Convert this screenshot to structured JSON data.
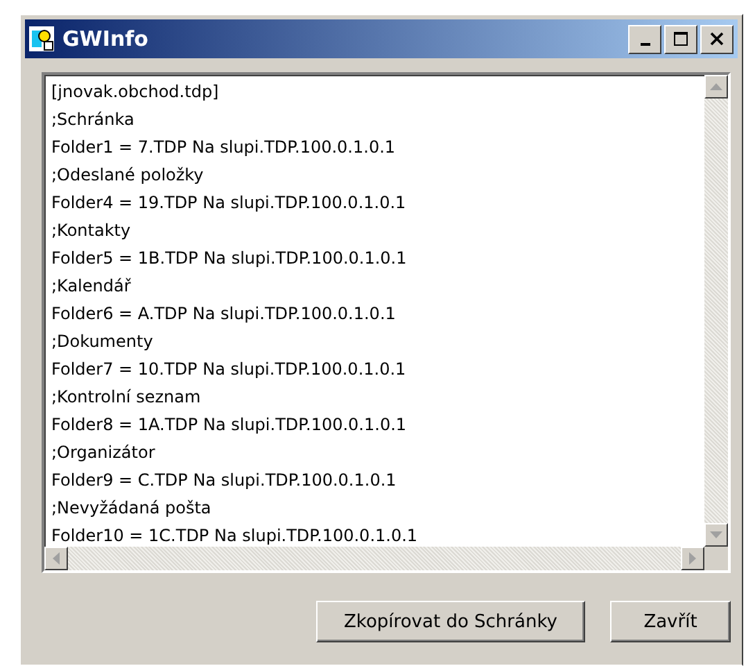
{
  "window": {
    "title": "GWInfo"
  },
  "text_lines": [
    "[jnovak.obchod.tdp]",
    ";Schránka",
    "Folder1 = 7.TDP Na slupi.TDP.100.0.1.0.1",
    ";Odeslané položky",
    "Folder4 = 19.TDP Na slupi.TDP.100.0.1.0.1",
    ";Kontakty",
    "Folder5 = 1B.TDP Na slupi.TDP.100.0.1.0.1",
    ";Kalendář",
    "Folder6 = A.TDP Na slupi.TDP.100.0.1.0.1",
    ";Dokumenty",
    "Folder7 = 10.TDP Na slupi.TDP.100.0.1.0.1",
    ";Kontrolní seznam",
    "Folder8 = 1A.TDP Na slupi.TDP.100.0.1.0.1",
    ";Organizátor",
    "Folder9 = C.TDP Na slupi.TDP.100.0.1.0.1",
    ";Nevyžádaná pošta",
    "Folder10 = 1C.TDP Na slupi.TDP.100.0.1.0.1"
  ],
  "buttons": [
    "Zkopírovat do Schránky",
    "Zavřít"
  ]
}
